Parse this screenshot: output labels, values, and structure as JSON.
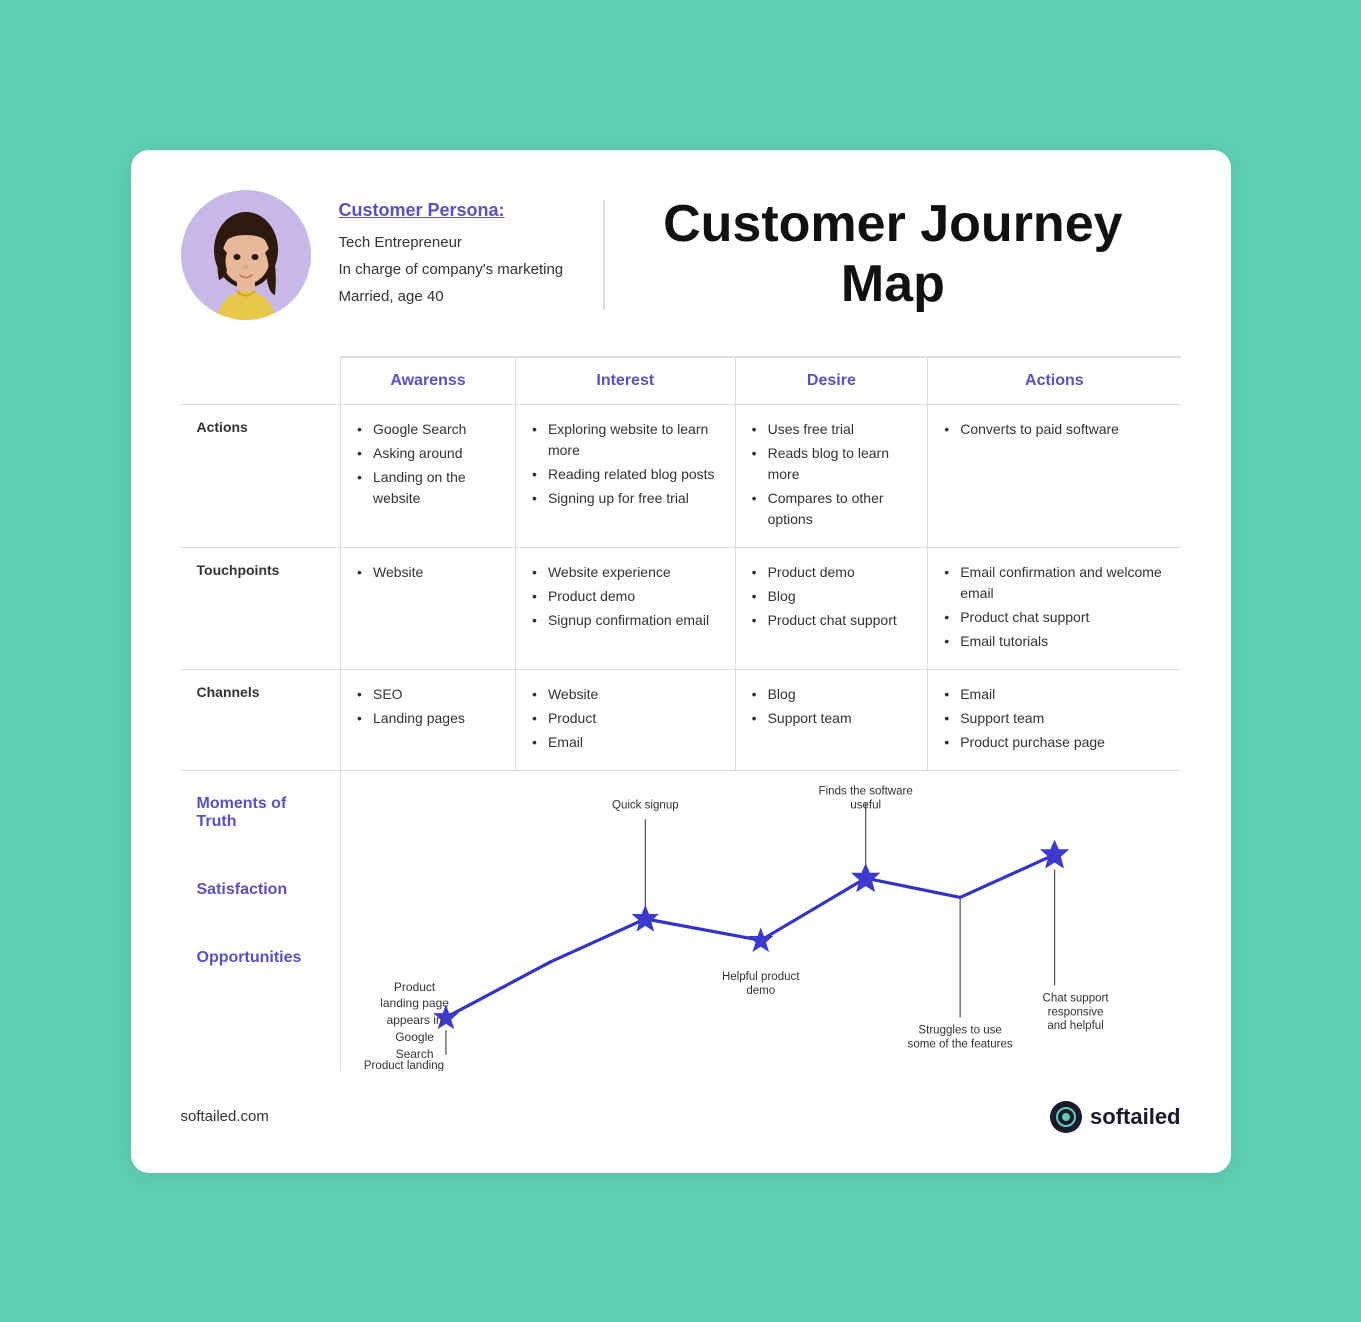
{
  "header": {
    "persona_label": "Customer Persona:",
    "persona_line1": "Tech Entrepreneur",
    "persona_line2": "In charge of company's marketing",
    "persona_line3": "Married, age 40",
    "main_title": "Customer Journey Map"
  },
  "table": {
    "columns": [
      "Awarenss",
      "Interest",
      "Desire",
      "Actions"
    ],
    "rows": [
      {
        "label": "Actions",
        "cells": [
          [
            "Google Search",
            "Asking around",
            "Landing on the website"
          ],
          [
            "Exploring website to learn more",
            "Reading related blog posts",
            "Signing up for free trial"
          ],
          [
            "Uses free trial",
            "Reads blog to learn more",
            "Compares to other options"
          ],
          [
            "Converts to paid software"
          ]
        ]
      },
      {
        "label": "Touchpoints",
        "cells": [
          [
            "Website"
          ],
          [
            "Website experience",
            "Product demo",
            "Signup confirmation email"
          ],
          [
            "Product demo",
            "Blog",
            "Product chat support"
          ],
          [
            "Email confirmation and welcome email",
            "Product chat support",
            "Email tutorials"
          ]
        ]
      },
      {
        "label": "Channels",
        "cells": [
          [
            "SEO",
            "Landing pages"
          ],
          [
            "Website",
            "Product",
            "Email"
          ],
          [
            "Blog",
            "Support team"
          ],
          [
            "Email",
            "Support team",
            "Product purchase page"
          ]
        ]
      }
    ],
    "bottom_labels": [
      "Moments of Truth",
      "Satisfaction",
      "Opportunities"
    ],
    "moments": [
      {
        "text": "Product landing page appears in Google Search",
        "x_pct": 15,
        "y_pct": 30
      },
      {
        "text": "Quick signup",
        "x_pct": 36,
        "y_pct": 10
      },
      {
        "text": "Helpful product demo",
        "x_pct": 50,
        "y_pct": 65
      },
      {
        "text": "Finds the software useful",
        "x_pct": 65,
        "y_pct": 18
      },
      {
        "text": "Struggles to use some of the features",
        "x_pct": 68,
        "y_pct": 75
      },
      {
        "text": "Chat support responsive and helpful",
        "x_pct": 88,
        "y_pct": 60
      }
    ]
  },
  "footer": {
    "domain": "softailed.com",
    "brand": "softailed"
  }
}
